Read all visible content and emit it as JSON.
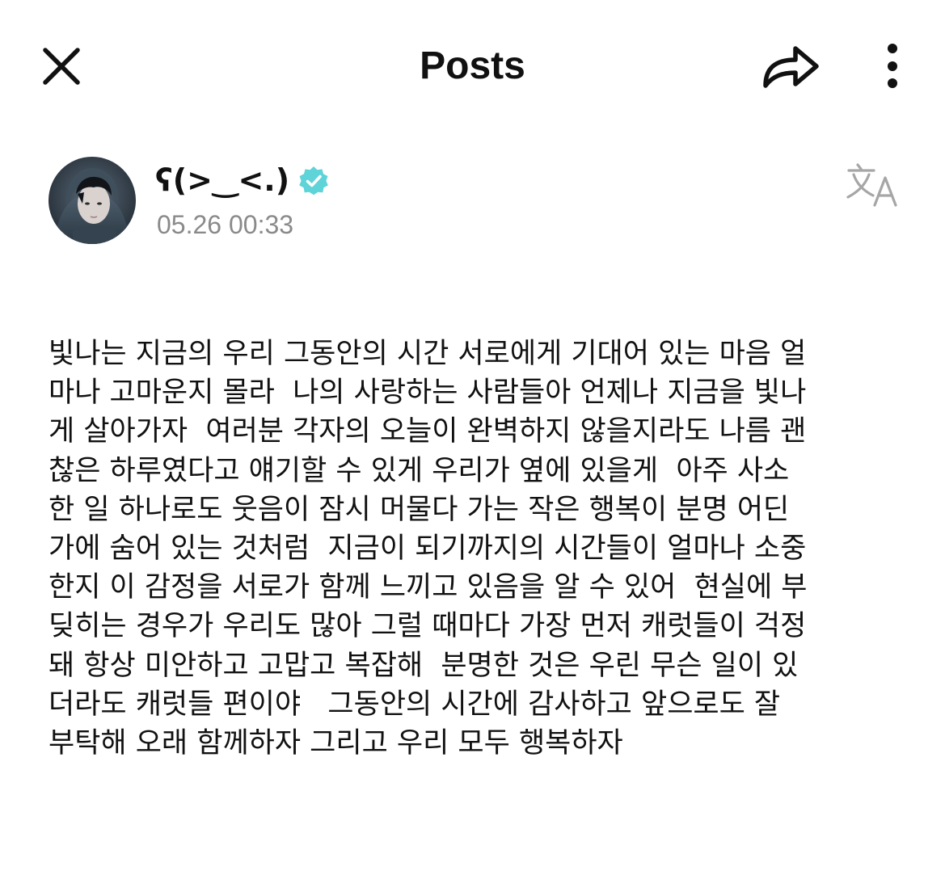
{
  "header": {
    "title": "Posts",
    "close_icon": "close-icon",
    "share_icon": "share-icon",
    "more_icon": "more-vertical-icon"
  },
  "author": {
    "name": "ʕ(>‿<.)",
    "verified_icon": "verified-badge-icon",
    "verified_color": "#5ed3d8",
    "timestamp": "05.26 00:33",
    "translate_icon": "translate-icon"
  },
  "post": {
    "lines": [
      "빛나는 지금의 우리 그동안의 시간 서로에게 기대어 있는 마음 얼",
      "마나 고마운지 몰라  나의 사랑하는 사람들아 언제나 지금을 빛나",
      "게 살아가자  여러분 각자의 오늘이 완벽하지 않을지라도 나름 괜",
      "찮은 하루였다고 얘기할 수 있게 우리가 옆에 있을게  아주 사소",
      "한 일 하나로도 웃음이 잠시 머물다 가는 작은 행복이 분명 어딘",
      "가에 숨어 있는 것처럼  지금이 되기까지의 시간들이 얼마나 소중",
      "한지 이 감정을 서로가 함께 느끼고 있음을 알 수 있어  현실에 부",
      "딪히는 경우가 우리도 많아 그럴 때마다 가장 먼저 캐럿들이 걱정",
      "돼 항상 미안하고 고맙고 복잡해  분명한 것은 우린 무슨 일이 있",
      "더라도 캐럿들 편이야   그동안의 시간에 감사하고 앞으로도 잘",
      "부탁해 오래 함께하자 그리고 우리 모두 행복하자"
    ]
  }
}
